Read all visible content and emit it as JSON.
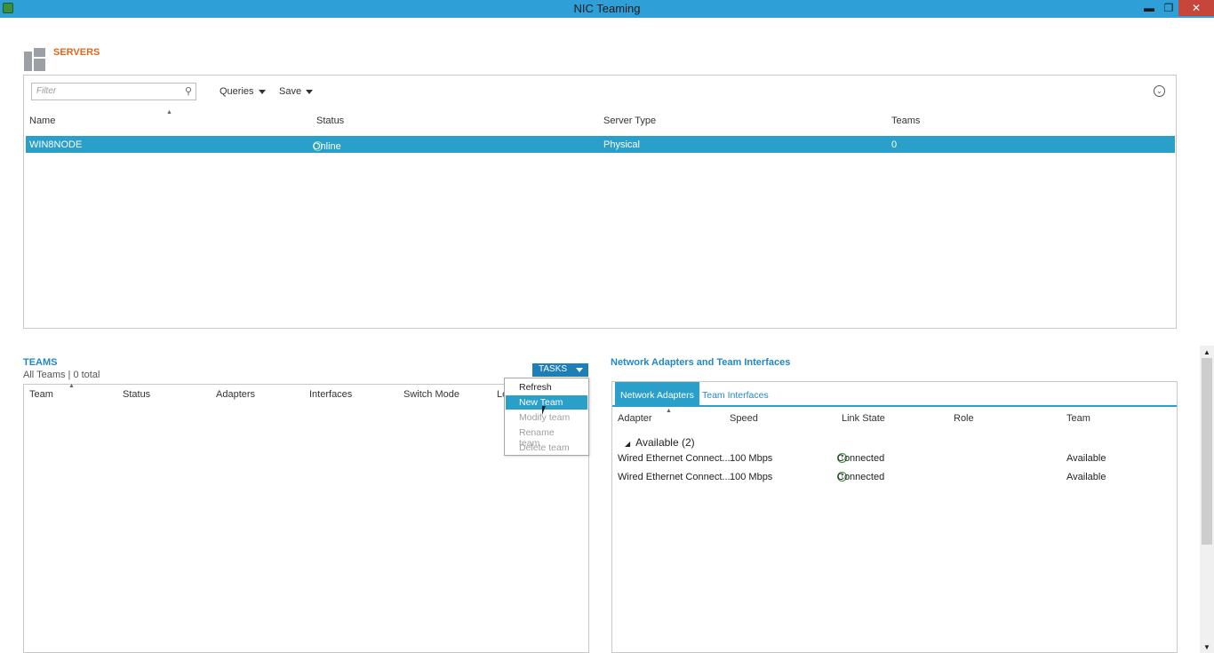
{
  "window": {
    "title": "NIC Teaming",
    "min_icon": "minimize-icon",
    "max_icon": "maximize-icon",
    "close_icon": "close-icon"
  },
  "servers": {
    "title": "SERVERS",
    "filter_placeholder": "Filter",
    "queries_label": "Queries",
    "save_label": "Save",
    "columns": [
      "Name",
      "Status",
      "Server Type",
      "Teams"
    ],
    "rows": [
      {
        "name": "WIN8NODE",
        "status": "Online",
        "server_type": "Physical",
        "teams": "0"
      }
    ]
  },
  "teams": {
    "title": "TEAMS",
    "subtitle": "All Teams | 0 total",
    "tasks_label": "TASKS",
    "columns": [
      "Team",
      "Status",
      "Adapters",
      "Interfaces",
      "Switch Mode",
      "Lo"
    ],
    "menu": [
      {
        "label": "Refresh",
        "enabled": true
      },
      {
        "label": "New Team",
        "enabled": true
      },
      {
        "label": "Modify team",
        "enabled": false
      },
      {
        "label": "Rename team",
        "enabled": false
      },
      {
        "label": "Delete team",
        "enabled": false
      }
    ]
  },
  "adapters": {
    "title": "Network Adapters and Team Interfaces",
    "tabs": [
      "Network Adapters",
      "Team Interfaces"
    ],
    "columns": [
      "Adapter",
      "Speed",
      "Link State",
      "Role",
      "Team"
    ],
    "group_label": "Available (2)",
    "rows": [
      {
        "adapter": "Wired Ethernet Connect...",
        "speed": "100 Mbps",
        "link_state": "Connected",
        "role": "",
        "team": "Available"
      },
      {
        "adapter": "Wired Ethernet Connect...",
        "speed": "100 Mbps",
        "link_state": "Connected",
        "role": "",
        "team": "Available"
      }
    ]
  },
  "colors": {
    "accent": "#2a9fc9",
    "titlebar": "#2f9fd8",
    "servers_title": "#e0661c",
    "status_green": "#2e9a2e"
  }
}
